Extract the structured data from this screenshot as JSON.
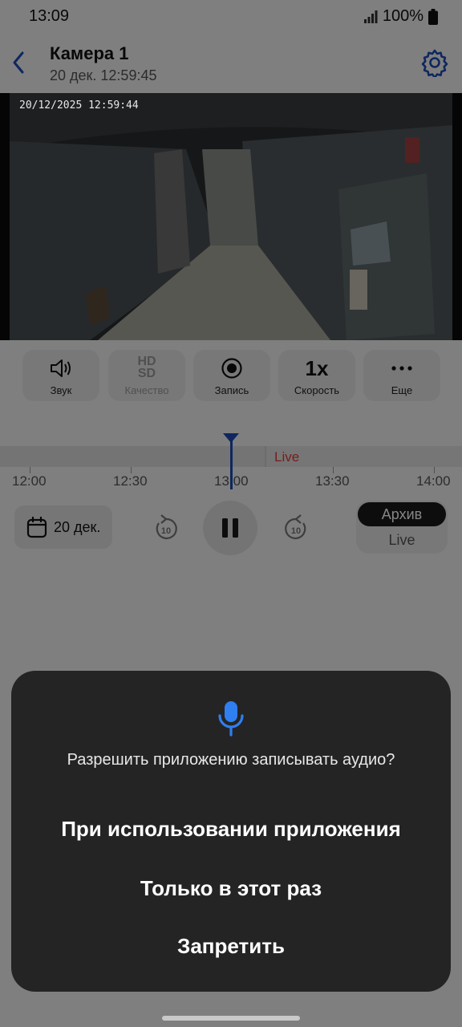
{
  "status": {
    "time": "13:09",
    "battery": "100%"
  },
  "header": {
    "title": "Камера 1",
    "subtitle": "20 дек. 12:59:45"
  },
  "video": {
    "osd_timestamp": "20/12/2025 12:59:44"
  },
  "controls": [
    {
      "label": "Звук",
      "icon": "speaker-icon"
    },
    {
      "label": "Качество",
      "icon": "hd-sd-icon",
      "hd": "HD",
      "sd": "SD"
    },
    {
      "label": "Запись",
      "icon": "record-icon"
    },
    {
      "label": "Скорость",
      "icon": "speed-text",
      "value": "1x"
    },
    {
      "label": "Еще",
      "icon": "more-icon"
    }
  ],
  "timeline": {
    "ticks": [
      "12:00",
      "12:30",
      "13:00",
      "13:30",
      "14:00"
    ],
    "live_label": "Live"
  },
  "playback": {
    "date_label": "20 дек.",
    "seek_back": "10",
    "seek_forward": "10",
    "mode_active": "Архив",
    "mode_inactive": "Live"
  },
  "dialog": {
    "prompt": "Разрешить приложению записывать аудио?",
    "option_while_using": "При использовании приложения",
    "option_once": "Только в этот раз",
    "option_deny": "Запретить"
  },
  "colors": {
    "accent": "#1d4bb5",
    "live": "#e53935",
    "dialog_bg": "#242424",
    "mic": "#2f7ff0"
  }
}
